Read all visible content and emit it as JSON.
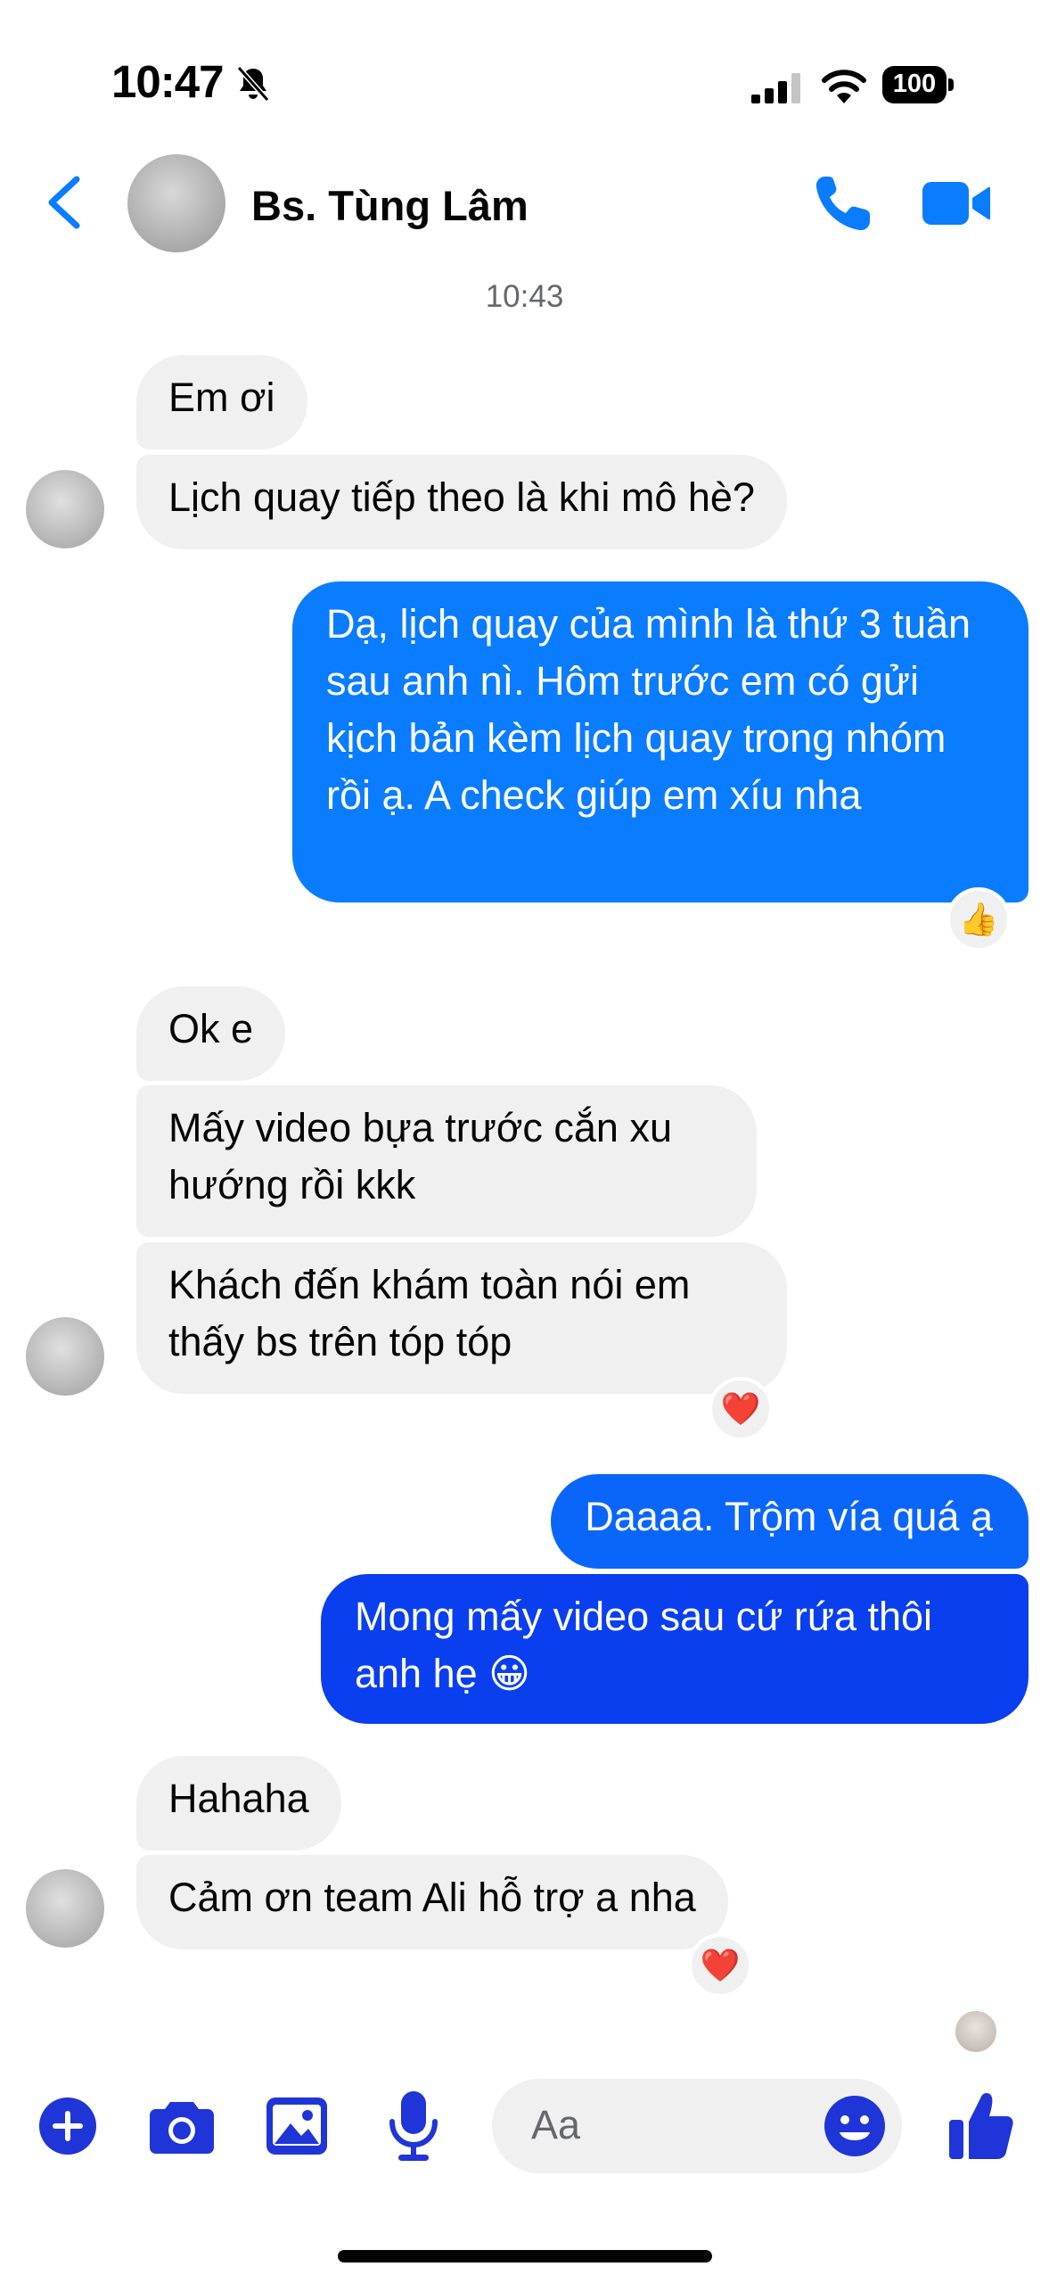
{
  "status_bar": {
    "time": "10:47",
    "battery": "100"
  },
  "header": {
    "contact_name": "Bs. Tùng Lâm"
  },
  "timestamp": "10:43",
  "messages": [
    {
      "from": "them",
      "text": "Em ơi"
    },
    {
      "from": "them",
      "text": "Lịch quay tiếp theo là khi mô hè?"
    },
    {
      "from": "me",
      "text": "Dạ, lịch quay của mình là thứ 3 tuần sau anh nì. Hôm trước em có gửi kịch bản kèm lịch quay trong nhóm rồi ạ. A check giúp em xíu nha",
      "reaction": "👍"
    },
    {
      "from": "them",
      "text": "Ok e"
    },
    {
      "from": "them",
      "text": "Mấy video bựa trước cắn xu hướng rồi kkk"
    },
    {
      "from": "them",
      "text": "Khách đến khám toàn nói em thấy bs trên tóp tóp",
      "reaction": "❤️"
    },
    {
      "from": "me",
      "text": "Daaaa. Trộm vía quá ạ"
    },
    {
      "from": "me",
      "text": "Mong mấy video sau cứ rứa thôi anh hẹ 😀"
    },
    {
      "from": "them",
      "text": "Hahaha"
    },
    {
      "from": "them",
      "text": "Cảm ơn team Ali hỗ trợ a nha",
      "reaction": "❤️"
    }
  ],
  "composer": {
    "placeholder": "Aa"
  },
  "colors": {
    "accent": "#0a7cff",
    "bubble_out_top": "#0a7cff",
    "bubble_out_bottom": "#0a3ff0",
    "bubble_in": "#f0f0f0",
    "tool_blue": "#1f35d8"
  },
  "icons": [
    "back-chevron-icon",
    "phone-icon",
    "video-camera-icon",
    "plus-icon",
    "camera-icon",
    "gallery-icon",
    "microphone-icon",
    "emoji-icon",
    "thumbs-up-icon",
    "bell-slash-icon",
    "signal-icon",
    "wifi-icon",
    "battery-icon"
  ]
}
